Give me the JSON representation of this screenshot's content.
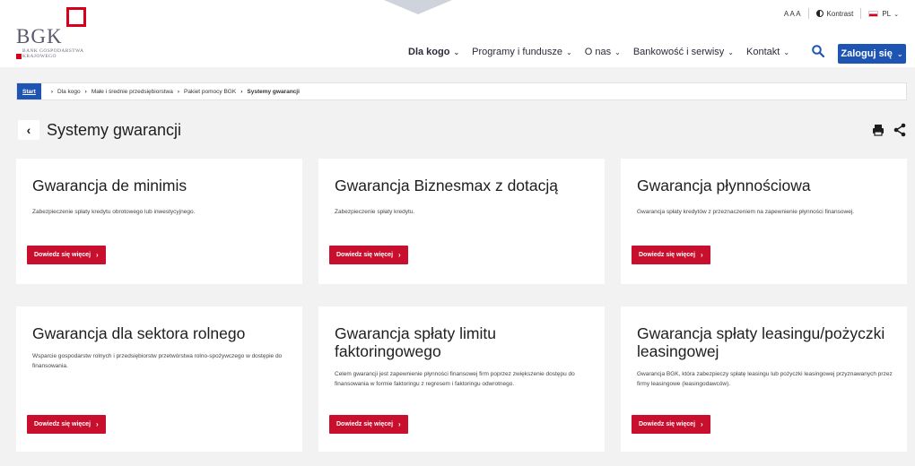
{
  "header": {
    "logo_text": "BGK",
    "logo_subtitle_line1": "BANK GOSPODARSTWA",
    "logo_subtitle_line2": "KRAJOWEGO",
    "font_size_control": "A A A",
    "contrast_label": "Kontrast",
    "language_label": "PL",
    "nav": [
      {
        "label": "Dla kogo",
        "active": true
      },
      {
        "label": "Programy i fundusze",
        "active": false
      },
      {
        "label": "O nas",
        "active": false
      },
      {
        "label": "Bankowość i serwisy",
        "active": false
      },
      {
        "label": "Kontakt",
        "active": false
      }
    ],
    "login_label": "Zaloguj się",
    "icons": {
      "search": "search-icon",
      "contrast": "contrast-icon",
      "flag": "flag-pl-icon",
      "chevron": "chevron-down-icon"
    }
  },
  "breadcrumb": {
    "start": "Start",
    "items": [
      "Dla kogo",
      "Małe i średnie przedsiębiorstwa",
      "Pakiet pomocy BGK"
    ],
    "current": "Systemy gwarancji"
  },
  "page": {
    "title": "Systemy gwarancji",
    "icons": {
      "back": "chevron-left-icon",
      "print": "print-icon",
      "share": "share-icon"
    }
  },
  "cards": [
    {
      "title": "Gwarancja de minimis",
      "description": "Zabezpieczenie spłaty kredytu obrotowego lub inwestycyjnego.",
      "button": "Dowiedz się więcej"
    },
    {
      "title": "Gwarancja Biznesmax z dotacją",
      "description": "Zabezpieczenie spłaty kredytu.",
      "button": "Dowiedz się więcej"
    },
    {
      "title": "Gwarancja płynnościowa",
      "description": "Gwarancja spłaty kredytów z przeznaczeniem na zapewnienie płynności finansowej.",
      "button": "Dowiedz się więcej"
    },
    {
      "title": "Gwarancja dla sektora rolnego",
      "description": "Wsparcie gospodarstw rolnych i przedsiębiorstw przetwórstwa rolno-spożywczego w dostępie do finansowania.",
      "button": "Dowiedz się więcej"
    },
    {
      "title": "Gwarancja spłaty limitu faktoringowego",
      "description": "Celem gwarancji jest zapewnienie płynności finansowej firm poprzez zwiększenie dostępu do finansowania w formie faktoringu z regresem i faktoringu odwrotnego.",
      "button": "Dowiedz się więcej"
    },
    {
      "title": "Gwarancja spłaty leasingu/pożyczki leasingowej",
      "description": "Gwarancja BGK, która zabezpieczy spłatę leasingu lub pożyczki leasingowej przyznawanych przez firmy leasingowe (leasingodawców).",
      "button": "Dowiedz się więcej"
    }
  ],
  "colors": {
    "brand_red": "#c8102e",
    "brand_blue": "#1e55b3",
    "background": "#f2f2f3"
  }
}
